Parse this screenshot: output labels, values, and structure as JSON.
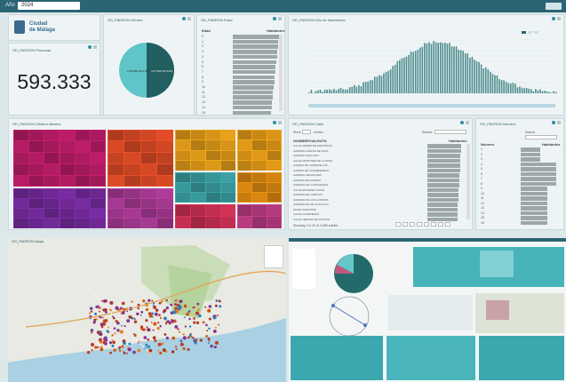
{
  "filter": {
    "label": "Año",
    "value": "2024"
  },
  "logo": {
    "line1": "Ciudad",
    "line2": "de Málaga"
  },
  "panels": {
    "personas": {
      "title": "OD_PADRON Personas",
      "value": "593.333"
    },
    "genero": {
      "title": "OD_PADRON Género"
    },
    "edad": {
      "title": "OD_PADRON Edad",
      "col1": "Edad",
      "col2": "Habitantes"
    },
    "nacimiento": {
      "title": "OD_PADRON Año de Nacimiento"
    },
    "distritos": {
      "title": "OD_PADRON Distritos Barrios"
    },
    "calle": {
      "title": "OD_PADRON Calle",
      "show_label": "Show",
      "entries_label": "entries",
      "search_label": "Search:",
      "col1": "NOMBREVIALRUTA",
      "col2": "Habitantes",
      "footer": "Showing 1 to 20 of 3.489 entries"
    },
    "numero": {
      "title": "OD_PADRON Número",
      "search_label": "Search:",
      "col1": "Número",
      "col2": "Habitantes"
    },
    "mapa": {
      "title": "OD_PADRON Mapa"
    }
  },
  "genero_labels": [
    "2,30.000 (48,17%)",
    "3,07.000 (51,83%)"
  ],
  "edad_rows": [
    "0",
    "1",
    "2",
    "3",
    "4",
    "5",
    "6",
    "7",
    "8",
    "9",
    "10",
    "11",
    "12",
    "13",
    "14",
    "15"
  ],
  "calle_rows": [
    "CALLE ARRIBA DE MARTIRIOS",
    "AVENIDA CARLOS DE HAYA",
    "AVENIDA JUAN XXIII",
    "CALLE MARTINEZ DE LA ROSA",
    "CAMINO DE CAMPANILLAS",
    "CAMINO DE CASABERMEJA",
    "AVENIDA VELAZQUEZ",
    "AVENIDA DE EUROPA",
    "AVENIDA DE LA ROSALEDA",
    "CALLE EDUARDO OCON",
    "AVENIDA DEL ARROYO",
    "AVENIDA DE LOS GUINDOS",
    "AVENIDA DE VALLE INCLAN",
    "PASEO MARITIMO",
    "CALLE CUARTEROS",
    "CALLE HEROES DE SOSTOA"
  ],
  "numero_rows": [
    "1",
    "2",
    "3",
    "4",
    "5",
    "6",
    "7",
    "8",
    "9",
    "10",
    "11",
    "12",
    "13",
    "14",
    "15",
    "16"
  ],
  "colors": {
    "topbar": "#2b6474",
    "teal": "#2e8fa3",
    "dark_teal": "#235f60",
    "pie_light": "#5fc5c9"
  }
}
